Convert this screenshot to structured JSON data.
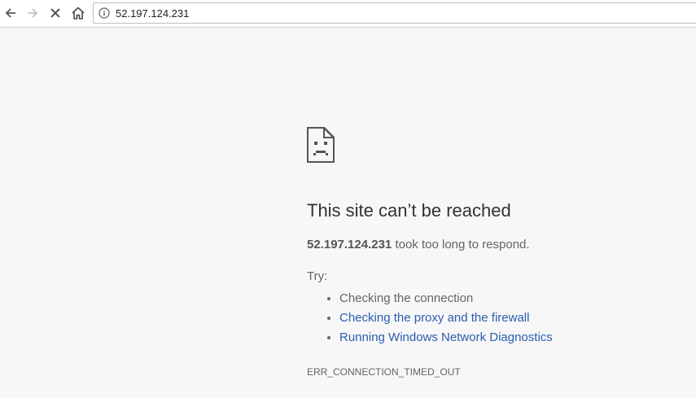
{
  "toolbar": {
    "back_icon": "arrow-left-icon",
    "forward_icon": "arrow-right-icon",
    "stop_icon": "close-icon",
    "home_icon": "home-icon",
    "info_icon": "info-icon",
    "url": "52.197.124.231"
  },
  "error_page": {
    "icon": "sad-document-icon",
    "heading": "This site can’t be reached",
    "host": "52.197.124.231",
    "detail_suffix": " took too long to respond.",
    "try_label": "Try:",
    "suggestions": [
      {
        "text": "Checking the connection",
        "is_link": false
      },
      {
        "text": "Checking the proxy and the firewall",
        "is_link": true
      },
      {
        "text": "Running Windows Network Diagnostics",
        "is_link": true
      }
    ],
    "error_code": "ERR_CONNECTION_TIMED_OUT"
  },
  "colors": {
    "page_background": "#f7f7f7",
    "link": "#2a5db0",
    "heading": "#333333",
    "body_text": "#646464"
  }
}
